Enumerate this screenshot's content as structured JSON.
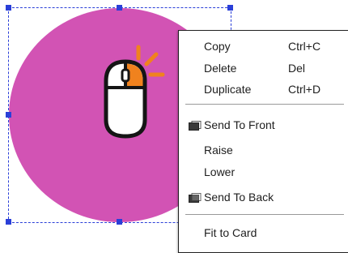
{
  "shape": {
    "fill_color": "#d253b4",
    "selection_color": "#2a3fd8",
    "icon": "mouse-click-icon",
    "icon_accent_color": "#f0821e"
  },
  "context_menu": {
    "items": [
      {
        "label": "Copy",
        "shortcut": "Ctrl+C"
      },
      {
        "label": "Delete",
        "shortcut": "Del"
      },
      {
        "label": "Duplicate",
        "shortcut": "Ctrl+D"
      },
      {
        "label": "Send To Front",
        "icon": "send-to-front-icon"
      },
      {
        "label": "Raise"
      },
      {
        "label": "Lower"
      },
      {
        "label": "Send To Back",
        "icon": "send-to-back-icon"
      },
      {
        "label": "Fit to Card"
      }
    ]
  }
}
